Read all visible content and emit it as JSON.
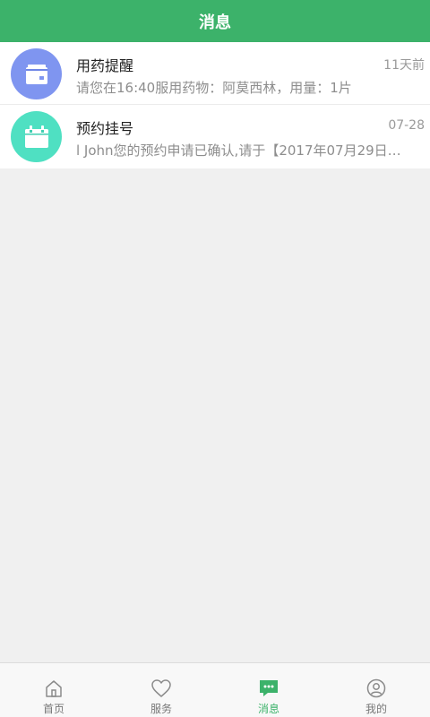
{
  "header": {
    "title": "消息"
  },
  "messages": [
    {
      "icon": "medicine-box-icon",
      "color": "#7f95f0",
      "title": "用药提醒",
      "time": "11天前",
      "content": "请您在16:40服用药物：阿莫西林，用量：1片"
    },
    {
      "icon": "calendar-icon",
      "color": "#4fe0c2",
      "title": "预约挂号",
      "time": "07-28",
      "content": "l John您的预约申请已确认,请于【2017年07月29日…"
    }
  ],
  "tabbar": {
    "active_color": "#3cb26a",
    "items": [
      {
        "label": "首页",
        "icon": "home-icon"
      },
      {
        "label": "服务",
        "icon": "heart-icon"
      },
      {
        "label": "消息",
        "icon": "message-icon",
        "active": true
      },
      {
        "label": "我的",
        "icon": "user-icon"
      }
    ]
  }
}
